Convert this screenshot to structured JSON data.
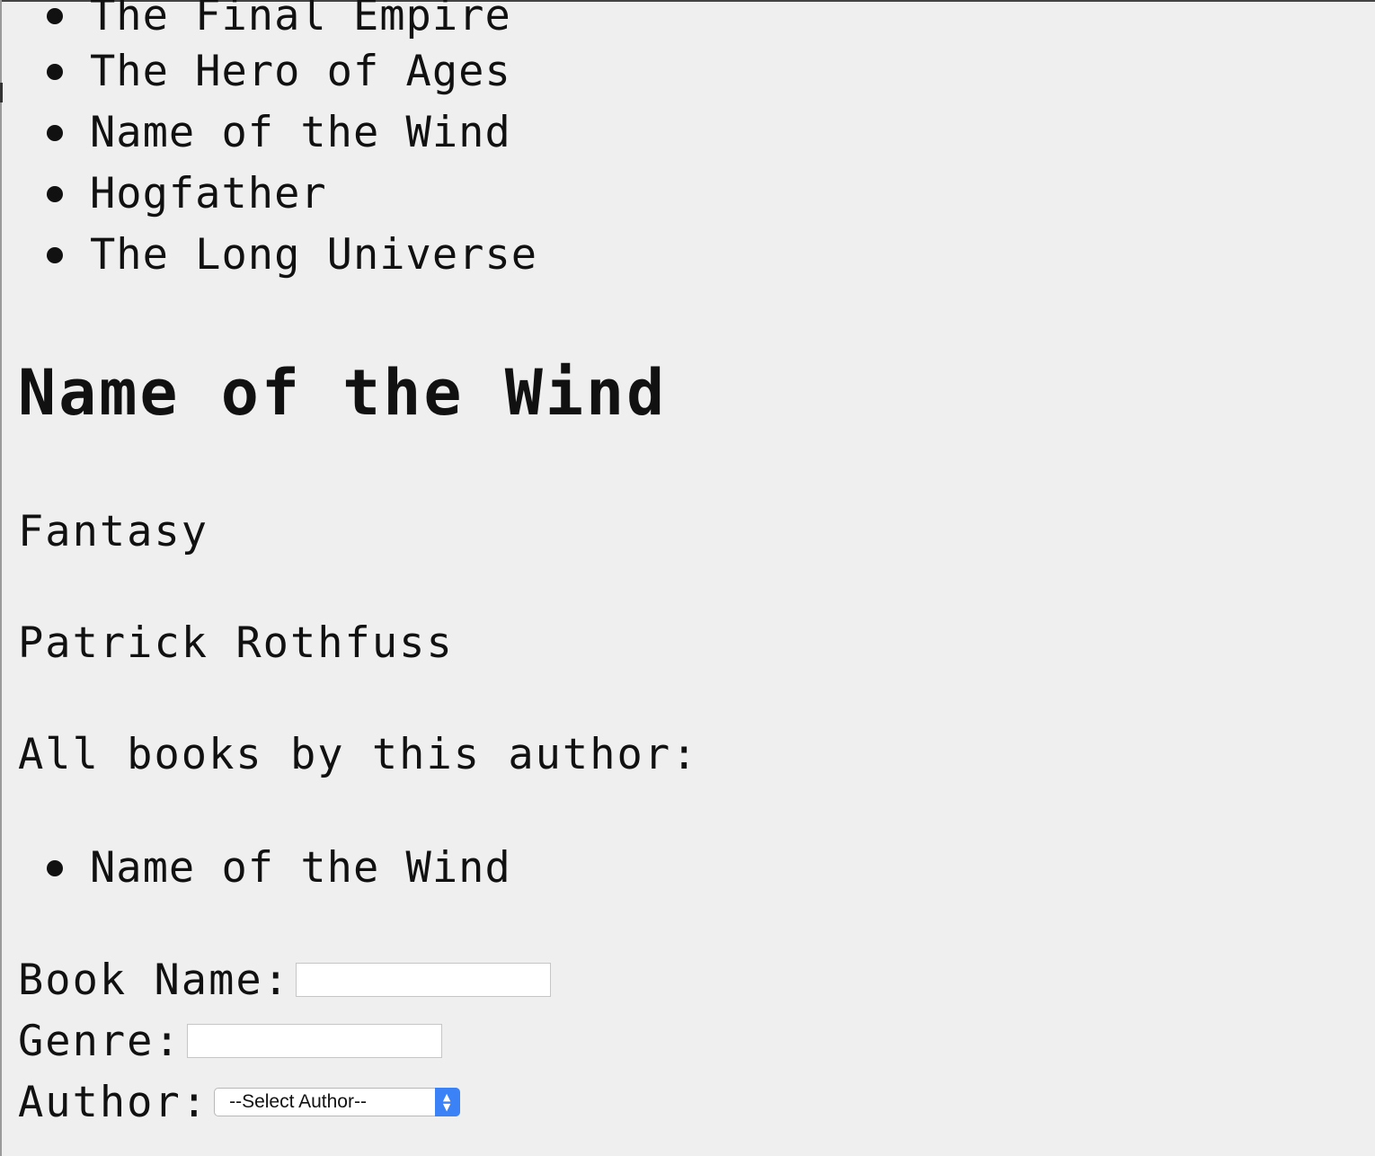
{
  "book_list": [
    "The Final Empire",
    "The Hero of Ages",
    "Name of the Wind",
    "Hogfather",
    "The Long Universe"
  ],
  "detail": {
    "title": "Name of the Wind",
    "genre": "Fantasy",
    "author": "Patrick Rothfuss",
    "all_books_heading": "All books by this author:",
    "author_books": [
      "Name of the Wind"
    ]
  },
  "form": {
    "book_name_label": "Book Name:",
    "book_name_value": "",
    "genre_label": "Genre:",
    "genre_value": "",
    "author_label": "Author:",
    "author_selected": "--Select Author--"
  },
  "icons": {
    "select_arrows": "chevron-up-down-icon",
    "bullet": "bullet-icon"
  },
  "colors": {
    "background": "#efefef",
    "select_accent": "#3b82f6"
  }
}
